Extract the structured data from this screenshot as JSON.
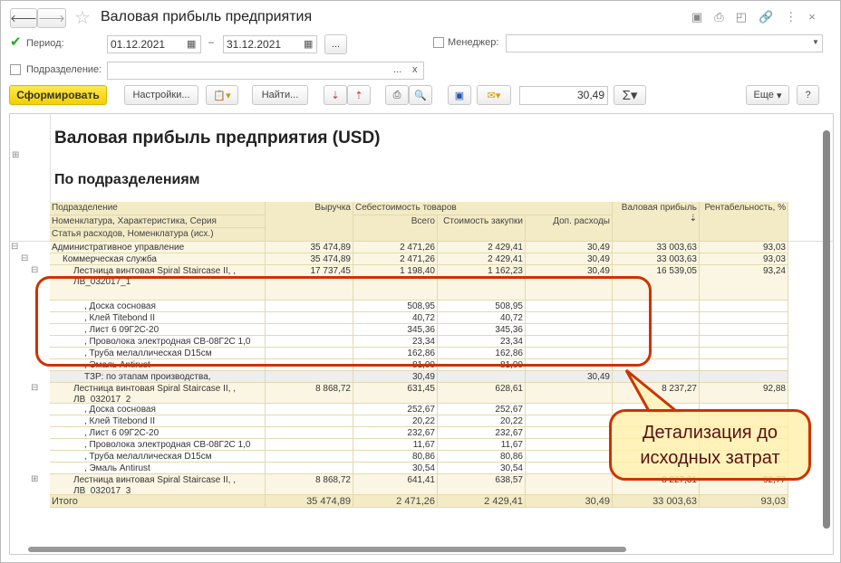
{
  "window": {
    "title": "Валовая прибыль предприятия"
  },
  "filters": {
    "period_label": "Период:",
    "period_checked": true,
    "date_from": "01.12.2021",
    "date_to": "31.12.2021",
    "dash": "–",
    "dots": "...",
    "manager_label": "Менеджер:",
    "manager_value": "",
    "department_label": "Подразделение:",
    "department_value": "",
    "clear": "x"
  },
  "toolbar": {
    "generate": "Сформировать",
    "settings": "Настройки...",
    "find": "Найти...",
    "sum_value": "30,49",
    "sigma": "Σ",
    "more": "Еще",
    "help": "?"
  },
  "report": {
    "title": "Валовая прибыль предприятия (USD)",
    "subtitle": "По подразделениям",
    "headers": {
      "h1": "Подразделение",
      "h2": "Номенклатура, Характеристика, Серия",
      "h3": "Статья расходов, Номенклатура (исх.)",
      "revenue": "Выручка",
      "cost_group": "Себестоимость товаров",
      "total": "Всего",
      "purchase": "Стоимость закупки",
      "extra": "Доп. расходы",
      "gross": "Валовая прибыль",
      "profitability": "Рентабельность, %"
    },
    "rows": [
      {
        "name": "Административное управление",
        "level": 0,
        "style": "group",
        "values": [
          "35 474,89",
          "2 471,26",
          "2 429,41",
          "30,49",
          "33 003,63",
          "93,03"
        ]
      },
      {
        "name": "Коммерческая служба",
        "level": 1,
        "style": "group",
        "values": [
          "35 474,89",
          "2 471,26",
          "2 429,41",
          "30,49",
          "33 003,63",
          "93,03"
        ]
      },
      {
        "name": "Лестница винтовая Spiral Staircase II, ,\nЛВ_032017_1",
        "level": 2,
        "style": "group",
        "values": [
          "17 737,45",
          "1 198,40",
          "1 162,23",
          "30,49",
          "16 539,05",
          "93,24"
        ]
      },
      {
        "name": ", Доска сосновая",
        "level": 3,
        "style": "item",
        "values": [
          "",
          "508,95",
          "508,95",
          "",
          "",
          ""
        ]
      },
      {
        "name": ", Клей Titebond II",
        "level": 3,
        "style": "item",
        "values": [
          "",
          "40,72",
          "40,72",
          "",
          "",
          ""
        ]
      },
      {
        "name": ", Лист 6 09Г2С-20",
        "level": 3,
        "style": "item",
        "values": [
          "",
          "345,36",
          "345,36",
          "",
          "",
          ""
        ]
      },
      {
        "name": ", Проволока электродная СВ-08Г2С 1,0 мм",
        "level": 3,
        "style": "item",
        "values": [
          "",
          "23,34",
          "23,34",
          "",
          "",
          ""
        ]
      },
      {
        "name": ", Труба мелаллическая D15см",
        "level": 3,
        "style": "item",
        "values": [
          "",
          "162,86",
          "162,86",
          "",
          "",
          ""
        ]
      },
      {
        "name": ", Эмаль Antirust",
        "level": 3,
        "style": "item",
        "values": [
          "",
          "81,00",
          "81,00",
          "",
          "",
          ""
        ]
      },
      {
        "name": "ТЗР: по этапам производства,",
        "level": 3,
        "style": "grey",
        "values": [
          "",
          "30,49",
          "",
          "30,49",
          "",
          ""
        ]
      },
      {
        "name": "Лестница винтовая Spiral Staircase II, ,\nЛВ_032017_2",
        "level": 2,
        "style": "group",
        "values": [
          "8 868,72",
          "631,45",
          "628,61",
          "",
          "8 237,27",
          "92,88"
        ]
      },
      {
        "name": ", Доска сосновая",
        "level": 3,
        "style": "item",
        "values": [
          "",
          "252,67",
          "252,67",
          "",
          "",
          ""
        ]
      },
      {
        "name": ", Клей Titebond II",
        "level": 3,
        "style": "item",
        "values": [
          "",
          "20,22",
          "20,22",
          "",
          "",
          ""
        ]
      },
      {
        "name": ", Лист 6 09Г2С-20",
        "level": 3,
        "style": "item",
        "values": [
          "",
          "232,67",
          "232,67",
          "",
          "",
          ""
        ]
      },
      {
        "name": ", Проволока электродная СВ-08Г2С 1,0 мм",
        "level": 3,
        "style": "item",
        "values": [
          "",
          "11,67",
          "11,67",
          "",
          "",
          ""
        ]
      },
      {
        "name": ", Труба мелаллическая D15см",
        "level": 3,
        "style": "item",
        "values": [
          "",
          "80,86",
          "80,86",
          "",
          "",
          ""
        ]
      },
      {
        "name": ", Эмаль Antirust",
        "level": 3,
        "style": "item",
        "values": [
          "",
          "30,54",
          "30,54",
          "",
          "",
          ""
        ]
      },
      {
        "name": "Лестница винтовая Spiral Staircase II, ,\nЛВ_032017_3",
        "level": 2,
        "style": "group",
        "values": [
          "8 868,72",
          "641,41",
          "638,57",
          "",
          "8 227,31",
          "92,77"
        ]
      }
    ],
    "total": {
      "name": "Итого",
      "values": [
        "35 474,89",
        "2 471,26",
        "2 429,41",
        "30,49",
        "33 003,63",
        "93,03"
      ]
    }
  },
  "annotation": {
    "text": "Детализация до исходных затрат",
    "color": "#cc3300"
  }
}
